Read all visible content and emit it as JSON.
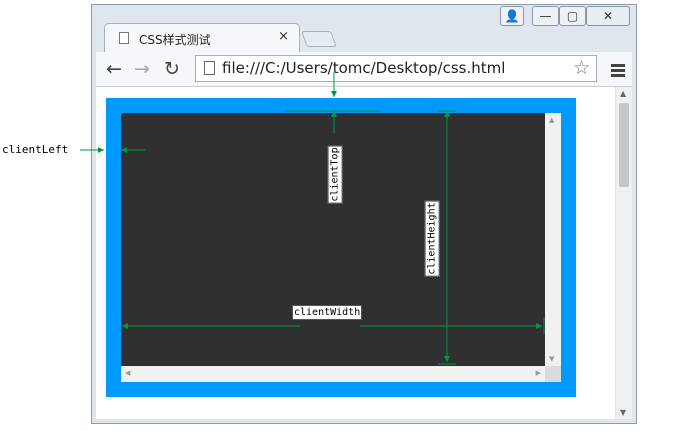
{
  "browser": {
    "tab_title": "CSS样式测试",
    "tab_close": "×",
    "url": "file:///C:/Users/tomc/Desktop/css.html",
    "back": "←",
    "forward": "→",
    "reload": "↻",
    "star": "☆",
    "win_user": "👤",
    "win_min": "—",
    "win_max": "▢",
    "win_close": "✕"
  },
  "annotations": {
    "client_left": "clientLeft",
    "client_top": "clientTop",
    "client_height": "clientHeight",
    "client_width": "clientWidth"
  },
  "colors": {
    "border": "#0099ff",
    "content": "#303030",
    "annotation_line": "#009944"
  },
  "icons": [
    "page-icon",
    "close-icon",
    "back-icon",
    "forward-icon",
    "reload-icon",
    "star-icon",
    "menu-icon",
    "user-icon",
    "minimize-icon",
    "maximize-icon",
    "window-close-icon"
  ]
}
